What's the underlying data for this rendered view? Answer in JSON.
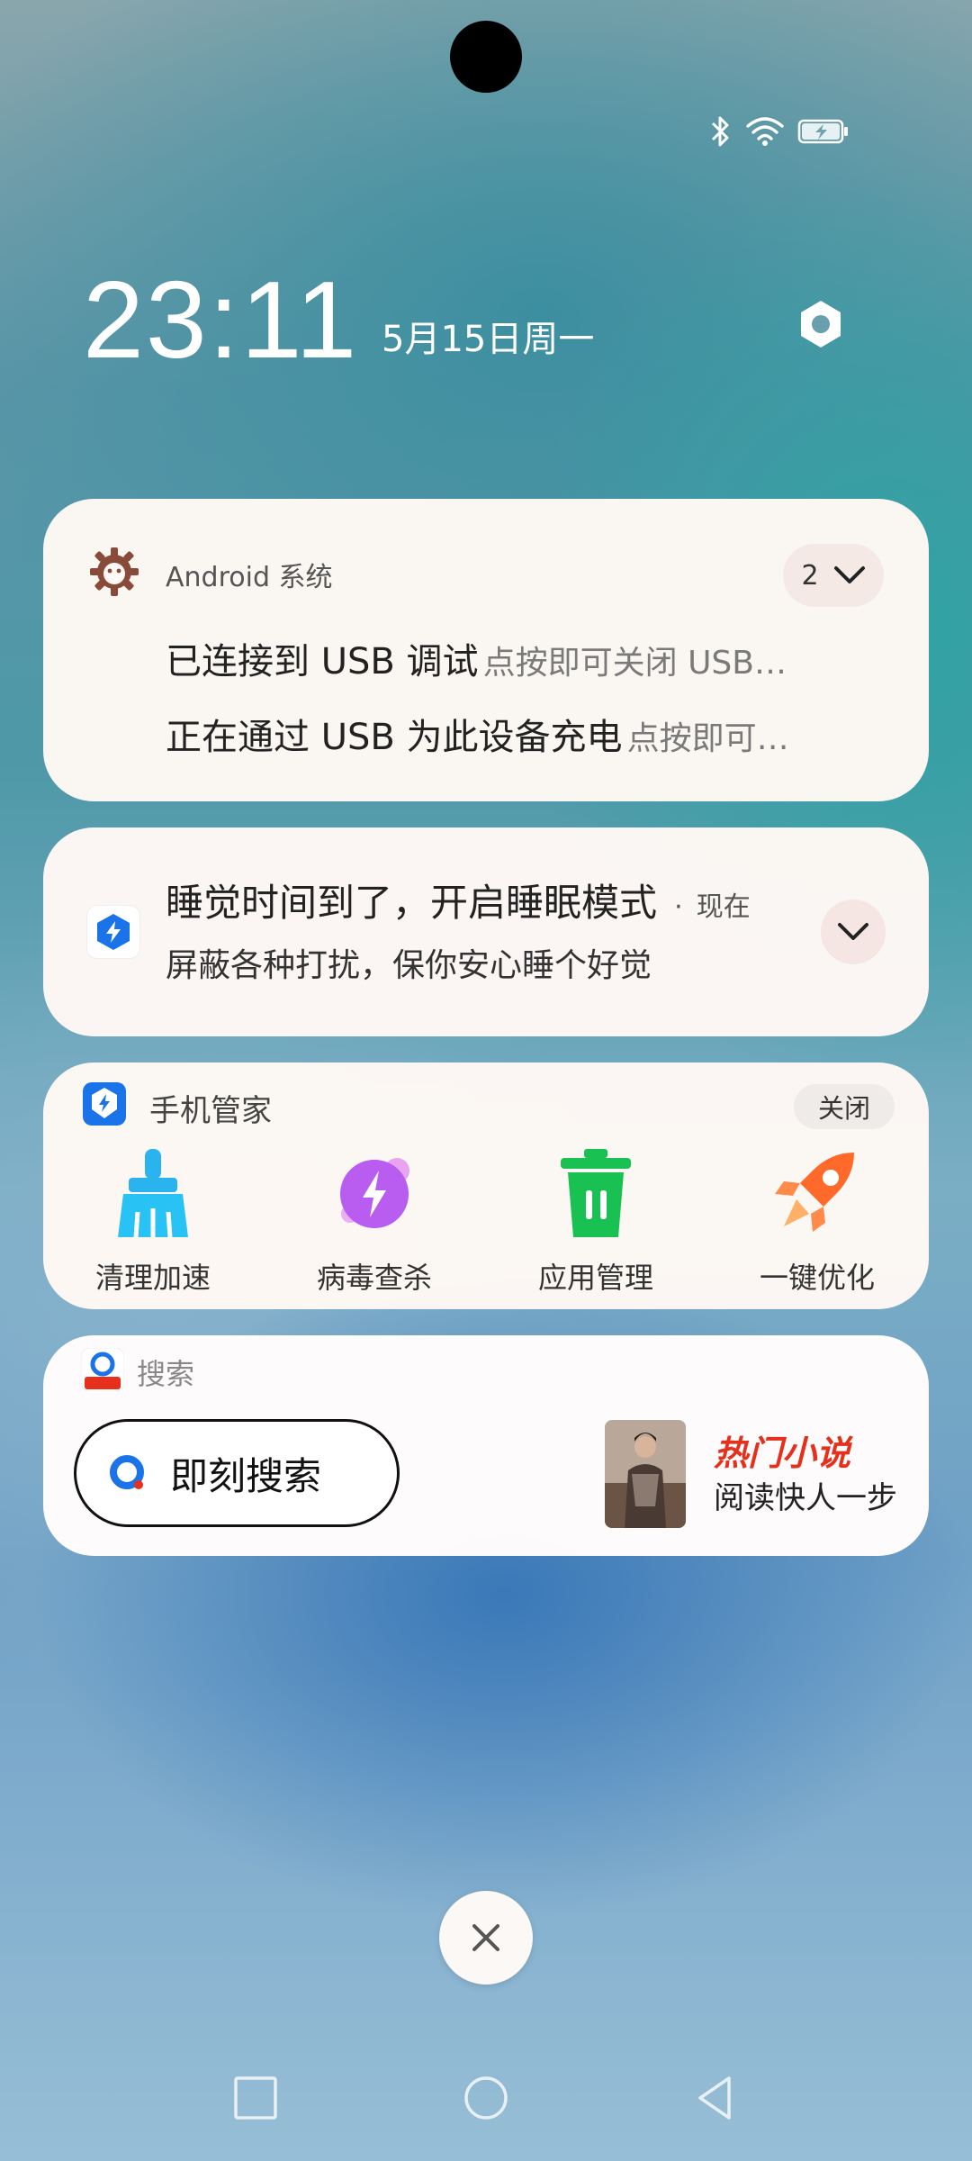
{
  "status_bar": {
    "icons": [
      "bluetooth-icon",
      "wifi-icon",
      "battery-charging-icon"
    ]
  },
  "lock": {
    "time": "23:11",
    "date": "5月15日周一"
  },
  "notifications": {
    "android": {
      "app_name": "Android 系统",
      "count": "2",
      "items": [
        {
          "title": "已连接到 USB 调试",
          "text": "点按即可关闭 USB…"
        },
        {
          "title": "正在通过 USB 为此设备充电",
          "text": "点按即可…"
        }
      ]
    },
    "sleep": {
      "title": "睡觉时间到了，开启睡眠模式",
      "dot": "·",
      "time": "现在",
      "text": "屏蔽各种打扰，保你安心睡个好觉"
    },
    "phone_manager": {
      "app_name": "手机管家",
      "close_label": "关闭",
      "tools": [
        {
          "label": "清理加速",
          "icon": "broom-icon"
        },
        {
          "label": "病毒查杀",
          "icon": "virus-scan-icon"
        },
        {
          "label": "应用管理",
          "icon": "trash-icon"
        },
        {
          "label": "一键优化",
          "icon": "rocket-icon"
        }
      ]
    },
    "search": {
      "app_name": "搜索",
      "search_label": "即刻搜索",
      "promo_title": "热门小说",
      "promo_text": "阅读快人一步"
    }
  },
  "nav": {
    "buttons": [
      "recents-square-icon",
      "home-circle-icon",
      "back-triangle-icon"
    ]
  },
  "colors": {
    "accent_blue": "#1a73e8",
    "green": "#19c153",
    "orange": "#ff6a2a",
    "promo_red": "#e5301c"
  }
}
